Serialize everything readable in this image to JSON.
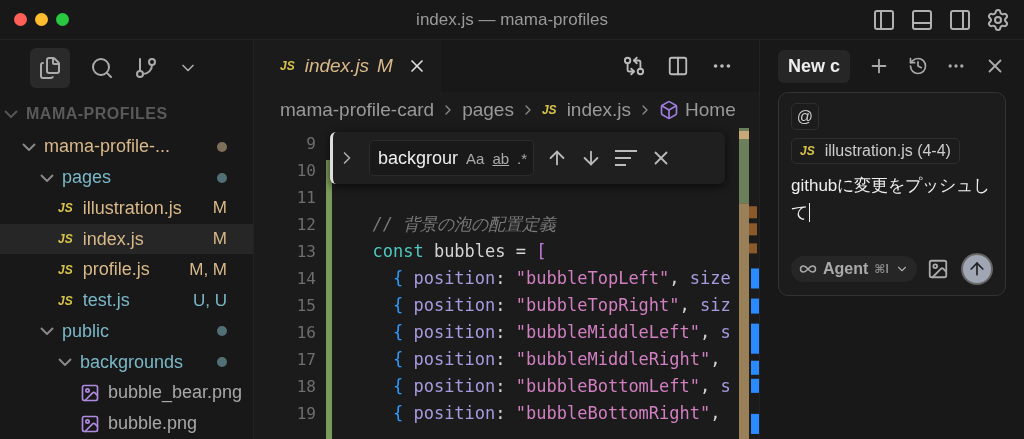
{
  "window": {
    "title": "index.js — mama-profiles"
  },
  "explorer": {
    "title": "MAMA-PROFILES",
    "expanded": true,
    "items": [
      {
        "kind": "folder",
        "label": "mama-profile-...",
        "expanded": true,
        "color": "#d9b98a",
        "dot": true,
        "children": [
          {
            "kind": "folder",
            "label": "pages",
            "expanded": true,
            "color": "#7ab8c8",
            "dot": true,
            "children": [
              {
                "kind": "js",
                "type_label": "JS",
                "label": "illustration.js",
                "badge": "M",
                "color": "#d9b98a",
                "selected": false
              },
              {
                "kind": "js",
                "type_label": "JS",
                "label": "index.js",
                "badge": "M",
                "color": "#d9b98a",
                "selected": true
              },
              {
                "kind": "js",
                "type_label": "JS",
                "label": "profile.js",
                "badge": "M, M",
                "color": "#d9b98a",
                "selected": false
              },
              {
                "kind": "js",
                "type_label": "JS",
                "label": "test.js",
                "badge": "U, U",
                "color": "#7ab8c8",
                "selected": false
              }
            ]
          },
          {
            "kind": "folder",
            "label": "public",
            "expanded": true,
            "color": "#7ab8c8",
            "dot": true,
            "children": [
              {
                "kind": "folder",
                "label": "backgrounds",
                "expanded": true,
                "color": "#7ab8c8",
                "dot": true,
                "children": [
                  {
                    "kind": "image",
                    "label": "bubble_bear.png",
                    "color": "#a8a8a8",
                    "selected": false
                  },
                  {
                    "kind": "image",
                    "label": "bubble.png",
                    "color": "#a8a8a8",
                    "selected": false
                  }
                ]
              }
            ]
          }
        ]
      }
    ]
  },
  "editor": {
    "tab": {
      "type_label": "JS",
      "label": "index.js",
      "badge": "M",
      "preview": true
    },
    "breadcrumb": [
      {
        "kind": "folder",
        "label": "mama-profile-card"
      },
      {
        "kind": "folder",
        "label": "pages"
      },
      {
        "kind": "js",
        "type_label": "JS",
        "label": "index.js"
      },
      {
        "kind": "symbol",
        "label": "Home"
      }
    ],
    "find": {
      "value": "backgrour",
      "options": [
        {
          "label": "Aa",
          "kind": "case"
        },
        {
          "label": "ab",
          "kind": "word"
        },
        {
          "label": ".*",
          "kind": "regex"
        }
      ]
    },
    "lines": [
      {
        "number": "9"
      },
      {
        "number": "10"
      },
      {
        "number": "11"
      },
      {
        "number": "12",
        "tokens": [
          {
            "kind": "comment",
            "text": "  // 背景の泡の配置定義"
          }
        ]
      },
      {
        "number": "13",
        "tokens": [
          {
            "kind": "keyword",
            "text": "  const"
          },
          {
            "kind": "plain",
            "text": " bubbles = "
          },
          {
            "kind": "bracket",
            "text": "["
          }
        ]
      },
      {
        "number": "14",
        "tokens": [
          {
            "kind": "brace",
            "text": "    {"
          },
          {
            "kind": "prop",
            "text": " position"
          },
          {
            "kind": "plain",
            "text": ": "
          },
          {
            "kind": "string",
            "text": "\"bubbleTopLeft\""
          },
          {
            "kind": "plain",
            "text": ", "
          },
          {
            "kind": "prop",
            "text": "size"
          }
        ]
      },
      {
        "number": "15",
        "tokens": [
          {
            "kind": "brace",
            "text": "    {"
          },
          {
            "kind": "prop",
            "text": " position"
          },
          {
            "kind": "plain",
            "text": ": "
          },
          {
            "kind": "string",
            "text": "\"bubbleTopRight\""
          },
          {
            "kind": "plain",
            "text": ", "
          },
          {
            "kind": "prop",
            "text": "siz"
          }
        ]
      },
      {
        "number": "16",
        "tokens": [
          {
            "kind": "brace",
            "text": "    {"
          },
          {
            "kind": "prop",
            "text": " position"
          },
          {
            "kind": "plain",
            "text": ": "
          },
          {
            "kind": "string",
            "text": "\"bubbleMiddleLeft\""
          },
          {
            "kind": "plain",
            "text": ", "
          },
          {
            "kind": "prop",
            "text": "s"
          }
        ]
      },
      {
        "number": "17",
        "tokens": [
          {
            "kind": "brace",
            "text": "    {"
          },
          {
            "kind": "prop",
            "text": " position"
          },
          {
            "kind": "plain",
            "text": ": "
          },
          {
            "kind": "string",
            "text": "\"bubbleMiddleRight\""
          },
          {
            "kind": "plain",
            "text": ","
          }
        ]
      },
      {
        "number": "18",
        "tokens": [
          {
            "kind": "brace",
            "text": "    {"
          },
          {
            "kind": "prop",
            "text": " position"
          },
          {
            "kind": "plain",
            "text": ": "
          },
          {
            "kind": "string",
            "text": "\"bubbleBottomLeft\""
          },
          {
            "kind": "plain",
            "text": ", "
          },
          {
            "kind": "prop",
            "text": "s"
          }
        ]
      },
      {
        "number": "19",
        "tokens": [
          {
            "kind": "brace",
            "text": "    {"
          },
          {
            "kind": "prop",
            "text": " position"
          },
          {
            "kind": "plain",
            "text": ": "
          },
          {
            "kind": "string",
            "text": "\"bubbleBottomRight\""
          },
          {
            "kind": "plain",
            "text": ","
          }
        ]
      }
    ]
  },
  "chat": {
    "tab": "New c",
    "context": {
      "type_label": "JS",
      "label": "illustration.js (4-4)"
    },
    "mention": "@",
    "message": "githubに変更をプッシュして",
    "mode": {
      "label": "Agent",
      "shortcut": "⌘I"
    }
  }
}
